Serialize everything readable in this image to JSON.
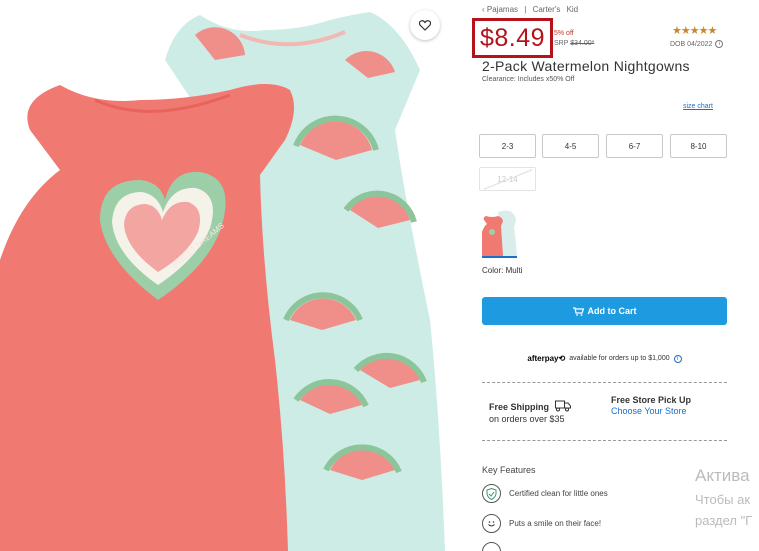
{
  "breadcrumb": {
    "items": [
      "‹ Pajamas",
      "|",
      "Carter's",
      "Kid"
    ]
  },
  "price": {
    "current": "$8.49",
    "percent_off": "5% off",
    "srp_label": "SRP",
    "srp_value": "$34.00*"
  },
  "rating": {
    "stars": "★★★★★",
    "dob": "DOB 04/2022"
  },
  "product": {
    "title": "2-Pack Watermelon Nightgowns",
    "clearance": "Clearance: Includes x50% Off"
  },
  "sizes": {
    "chart_link": "size chart",
    "options": [
      {
        "label": "2-3",
        "available": true
      },
      {
        "label": "4-5",
        "available": true
      },
      {
        "label": "6-7",
        "available": true
      },
      {
        "label": "8-10",
        "available": true
      },
      {
        "label": "12-14",
        "available": false
      }
    ]
  },
  "color": {
    "label": "Color: Multi"
  },
  "cart": {
    "button_label": "Add to Cart"
  },
  "afterpay": {
    "brand": "afterpay⟲",
    "text": "available for orders up to $1,000"
  },
  "shipping": {
    "title": "Free Shipping",
    "subtitle": "on orders over $35"
  },
  "pickup": {
    "title": "Free Store Pick Up",
    "link": "Choose Your Store"
  },
  "features": {
    "title": "Key Features",
    "items": [
      {
        "text": "Certified clean for little ones",
        "icon": "shield-check-icon"
      },
      {
        "text": "Puts a smile on their face!",
        "icon": "smiley-icon"
      }
    ]
  },
  "watermark": {
    "line1": "Актива",
    "line2": "Чтобы ак",
    "line3": "раздел \"Г"
  },
  "colors": {
    "price_red": "#b5121b",
    "cart_blue": "#1e9be0",
    "link_blue": "#1a6fc9",
    "star_gold": "#c9882f",
    "gown_coral": "#f07a72",
    "gown_mint": "#cdece6"
  }
}
